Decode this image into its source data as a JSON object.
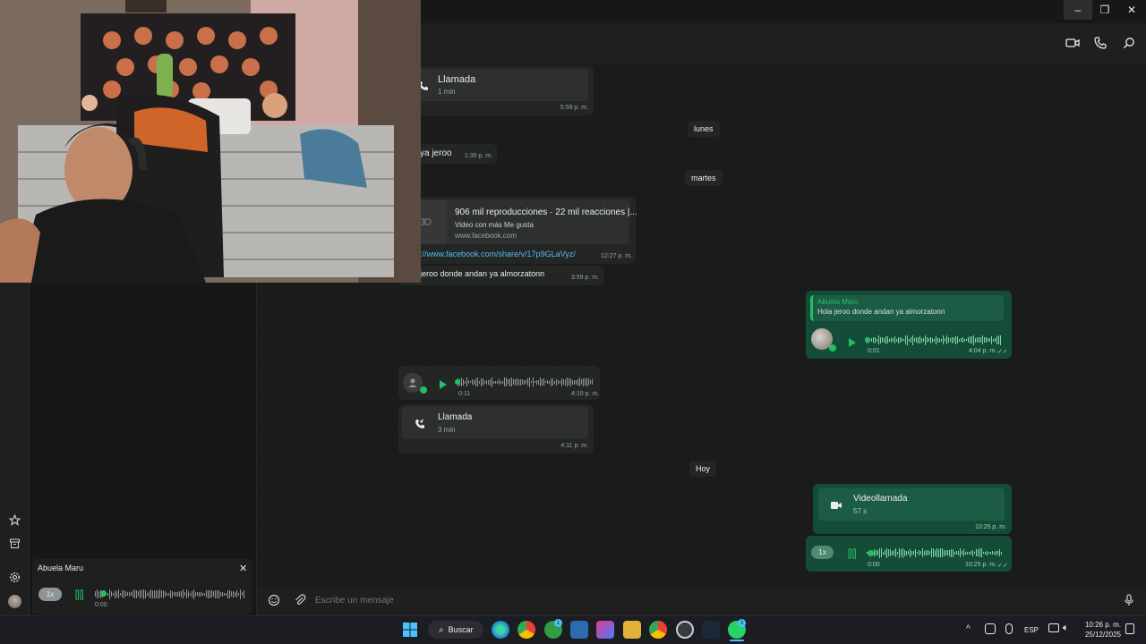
{
  "window": {
    "minimize": "–",
    "maximize": "❐",
    "close": "✕"
  },
  "header_icons": [
    "video-call-icon",
    "voice-call-icon",
    "search-icon"
  ],
  "chat": {
    "messages": [
      {
        "kind": "call",
        "title": "Llamada",
        "duration": "1 min",
        "time": "5:59 p. m."
      },
      {
        "kind": "day",
        "label": "lunes"
      },
      {
        "kind": "text",
        "text": "ya jeroo",
        "time": "1:35 p. m."
      },
      {
        "kind": "day",
        "label": "martes"
      },
      {
        "kind": "link",
        "title": "906 mil reproducciones · 22 mil reacciones |...",
        "sub": "Video con más Me gusta",
        "domain": "www.facebook.com",
        "url": "://www.facebook.com/share/v/17p9GLaVyz/",
        "time": "12:27 p. m."
      },
      {
        "kind": "text",
        "text": "jeroo donde andan ya almorzatonn",
        "time": "3:59 p. m."
      },
      {
        "kind": "reply-audio",
        "quoted_author": "Abuela Maru",
        "quoted_text": "Hola jeroo donde andan ya almorzatonn",
        "duration": "0:01",
        "time": "4:04 p. m."
      },
      {
        "kind": "audio",
        "duration": "0:11",
        "time": "4:10 p. m."
      },
      {
        "kind": "call",
        "title": "Llamada",
        "duration": "3 min",
        "time": "4:11 p. m."
      },
      {
        "kind": "day",
        "label": "Hoy"
      },
      {
        "kind": "videocall",
        "title": "Videollamada",
        "duration": "57 s",
        "time": "10:25 p. m."
      },
      {
        "kind": "audio-out",
        "speed": "1x",
        "duration": "0:00",
        "time": "10:25 p. m."
      }
    ]
  },
  "composer": {
    "placeholder": "Escribe un mensaje"
  },
  "mini_player": {
    "name": "Abuela Maru",
    "speed": "1x",
    "time": "0:00"
  },
  "taskbar": {
    "search_label": "Buscar",
    "lang": "ESP",
    "time": "10:26 p. m.",
    "date": "25/12/2025",
    "badge_xbox": "1",
    "badge_whatsapp": "3"
  },
  "colors": {
    "accent": "#21c063",
    "bubble_out": "#144d37",
    "bubble_in": "#242626",
    "bg": "#161717"
  }
}
